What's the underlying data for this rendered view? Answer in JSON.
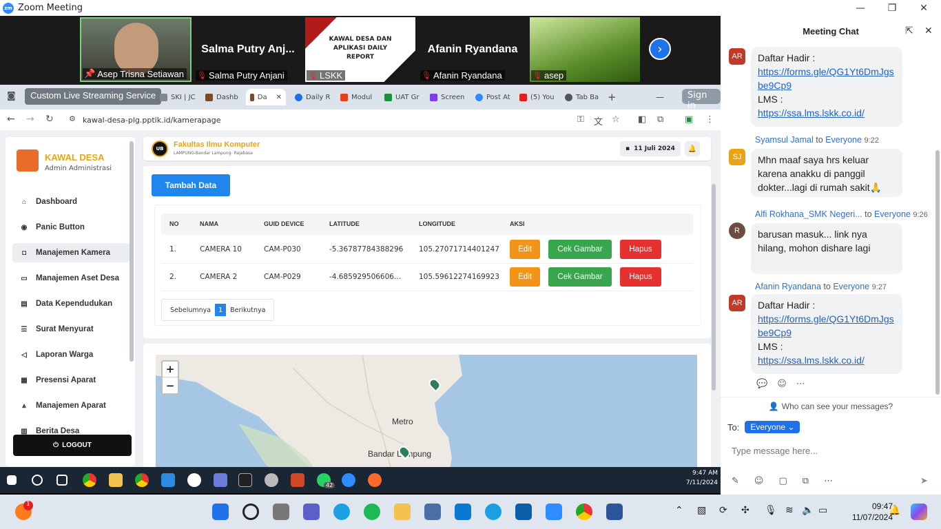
{
  "window": {
    "title": "Zoom Meeting"
  },
  "participants": [
    {
      "name": "Asep Trisna Setiawan",
      "big": ""
    },
    {
      "name": "Salma Putry Anjani",
      "big": "Salma Putry Anj..."
    },
    {
      "name": "LSKK",
      "big": "",
      "slide_title": "KAWAL DESA DAN APLIKASI DAILY REPORT"
    },
    {
      "name": "Afanin Ryandana",
      "big": "Afanin Ryandana"
    },
    {
      "name": "asep",
      "big": ""
    }
  ],
  "browser": {
    "streaming_label": "Custom Live Streaming Service",
    "tabs": [
      "SKI | JC",
      "Dashb",
      "Da",
      "Daily R",
      "Modul",
      "UAT Gr",
      "Screen",
      "Post At",
      "(5) You",
      "Tab Ba"
    ],
    "signin": "Sign in",
    "url": "kawal-desa-plg.pptik.id/kamerapage"
  },
  "app": {
    "brand_title": "KAWAL DESA",
    "brand_sub": "Admin Administrasi",
    "menu": [
      {
        "label": "Dashboard",
        "icon": "home-icon"
      },
      {
        "label": "Panic Button",
        "icon": "dot-icon"
      },
      {
        "label": "Manajemen Kamera",
        "icon": "camera-icon"
      },
      {
        "label": "Manajemen Aset Desa",
        "icon": "box-icon"
      },
      {
        "label": "Data Kependudukan",
        "icon": "id-card-icon"
      },
      {
        "label": "Surat Menyurat",
        "icon": "list-icon"
      },
      {
        "label": "Laporan Warga",
        "icon": "megaphone-icon"
      },
      {
        "label": "Presensi Aparat",
        "icon": "table-icon"
      },
      {
        "label": "Manajemen Aparat",
        "icon": "users-icon"
      },
      {
        "label": "Berita Desa",
        "icon": "news-icon"
      }
    ],
    "logout": "LOGOUT",
    "header_title": "Fakultas Ilmu Komputer",
    "header_sub": "LAMPUNG-Bandar Lampung- Rajabasa",
    "date": "11 Juli 2024",
    "add_button": "Tambah Data",
    "table": {
      "headers": [
        "NO",
        "NAMA",
        "GUID DEVICE",
        "LATITUDE",
        "LONGITUDE",
        "AKSI"
      ],
      "rows": [
        [
          "1.",
          "CAMERA 10",
          "CAM-P030",
          "-5.36787784388296",
          "105.27071714401247"
        ],
        [
          "2.",
          "CAMERA 2",
          "CAM-P029",
          "-4.685929506606...",
          "105.59612274169923"
        ]
      ],
      "actions": [
        "Edit",
        "Cek Gambar",
        "Hapus"
      ]
    },
    "pager": {
      "prev": "Sebelumnya",
      "page": "1",
      "next": "Berikutnya"
    },
    "map": {
      "labels": [
        "Metro",
        "Bandar Lampung"
      ]
    }
  },
  "inner_taskbar": {
    "time": "9:47 AM",
    "date": "7/11/2024",
    "badge": "42"
  },
  "chat": {
    "title": "Meeting Chat",
    "messages": [
      {
        "avatar": "AR",
        "color": "#c0392b",
        "sender": "",
        "to": "",
        "time": "",
        "lines": [
          "Daftar Hadir :"
        ],
        "link1": "https://forms.gle/QG1Yt6DmJgsbe9Cp9",
        "label2": "LMS :",
        "link2": "https://ssa.lms.lskk.co.id/"
      },
      {
        "avatar": "SJ",
        "color": "#e8a317",
        "sender": "Syamsul Jamal",
        "to": "Everyone",
        "time": "9:22",
        "text": "Mhn maaf saya hrs keluar karena anakku di panggil dokter...lagi di rumah sakit🙏"
      },
      {
        "avatar": "R",
        "color": "#6d4c41",
        "sender": "Alfi Rokhana_SMK Negeri...",
        "to": "Everyone",
        "time": "9:26",
        "text": "barusan masuk... link nya hilang, mohon dishare lagi"
      },
      {
        "avatar": "AR",
        "color": "#c0392b",
        "sender": "Afanin Ryandana",
        "to": "Everyone",
        "time": "9:27",
        "lines": [
          "Daftar Hadir :"
        ],
        "link1": "https://forms.gle/QG1Yt6DmJgsbe9Cp9",
        "label2": "LMS :",
        "link2": "https://ssa.lms.lskk.co.id/"
      }
    ],
    "to_word": "to",
    "who_can_see": "Who can see your messages?",
    "to_label": "To:",
    "recipient": "Everyone",
    "placeholder": "Type message here..."
  },
  "taskbar": {
    "time": "09:47",
    "date": "11/07/2024",
    "notif_badge": "1"
  }
}
